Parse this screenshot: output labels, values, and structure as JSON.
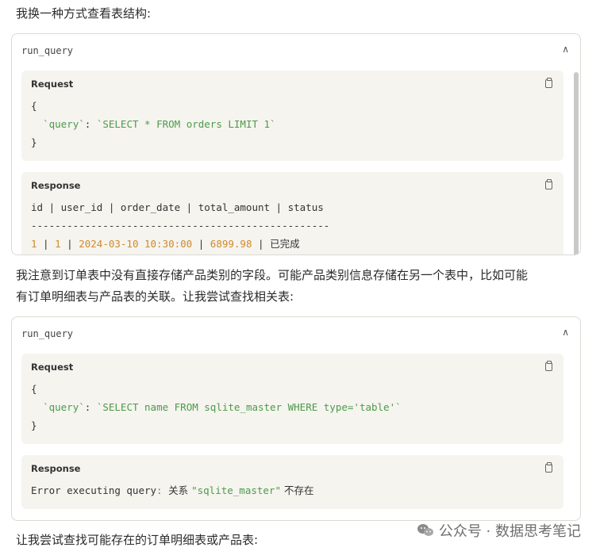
{
  "intro_text": "我换一种方式查看表结构:",
  "card1": {
    "tool": "run_query",
    "request_label": "Request",
    "request_lines": [
      "{",
      "}"
    ],
    "request_key": "`query`",
    "request_sep": ": ",
    "request_value": "`SELECT * FROM orders LIMIT 1`",
    "response_label": "Response",
    "response_header": "id | user_id | order_date | total_amount | status",
    "response_divider": "--------------------------------------------------",
    "row": {
      "id": "1",
      "user_id": "1",
      "order_date": "2024-03-10 10:30:00",
      "total_amount": "6899.98",
      "status": "已完成"
    }
  },
  "middle_text_1": "我注意到订单表中没有直接存储产品类别的字段。可能产品类别信息存储在另一个表中，比如可能",
  "middle_text_2": "有订单明细表与产品表的关联。让我尝试查找相关表:",
  "card2": {
    "tool": "run_query",
    "request_label": "Request",
    "request_lines": [
      "{",
      "}"
    ],
    "request_key": "`query`",
    "request_sep": ": ",
    "request_value": "`SELECT name FROM sqlite_master WHERE type='table'`",
    "response_label": "Response",
    "error_prefix": "Error executing query",
    "error_colon": ": ",
    "error_cn1": "关系 ",
    "error_name": "\"sqlite_master\"",
    "error_cn2": " 不存在"
  },
  "bottom_text": "让我尝试查找可能存在的订单明细表或产品表:",
  "watermark": "公众号 · 数据思考笔记",
  "colors": {
    "accent_green": "#4e9a4a",
    "number_orange": "#d08a2b",
    "panel_bg": "#f5f4ef"
  }
}
